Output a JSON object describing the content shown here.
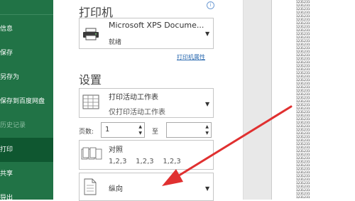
{
  "sidebar": {
    "items": [
      {
        "label": "信息",
        "state": "normal"
      },
      {
        "label": "保存",
        "state": "normal"
      },
      {
        "label": "另存为",
        "state": "normal"
      },
      {
        "label": "保存到百度网盘",
        "state": "normal"
      },
      {
        "label": "历史记录",
        "state": "disabled"
      },
      {
        "label": "打印",
        "state": "active"
      },
      {
        "label": "共享",
        "state": "normal"
      },
      {
        "label": "导出",
        "state": "normal"
      }
    ]
  },
  "printer": {
    "section_title": "打印机",
    "name": "Microsoft XPS Docume...",
    "status": "就绪",
    "properties_link": "打印机属性",
    "icon": "printer-icon",
    "info_icon": "info-icon"
  },
  "settings": {
    "section_title": "设置",
    "scope": {
      "title": "打印活动工作表",
      "subtitle": "仅打印活动工作表",
      "icon": "worksheet-grid-icon"
    },
    "pages": {
      "label": "页数:",
      "from": "1",
      "to_label": "至",
      "to": ""
    },
    "collate": {
      "title": "对照",
      "subtitle": "1,2,3    1,2,3    1,2,3",
      "icon": "collate-icon"
    },
    "orientation": {
      "title": "纵向",
      "icon": "portrait-page-icon"
    }
  },
  "preview": {
    "cells": [
      "1231231",
      "1231231",
      "1231231",
      "1231231",
      "1231231",
      "1231231",
      "1231231",
      "1231231",
      "1231231",
      "1231231",
      "1231231",
      "1231231",
      "1231231",
      "1231231",
      "1231231",
      "1231231",
      "1231231",
      "1231231",
      "1231231",
      "1231231",
      "1231231",
      "1231231",
      "1231231",
      "1231231",
      "1231231",
      "1231231",
      "1231231",
      "1231231",
      "1231231",
      "1231231",
      "1231231",
      "1231231",
      "1231231",
      "1231231",
      "1231231",
      "1231231",
      "1231231",
      "1231231",
      "1231231",
      "1231231",
      "1231231",
      "1231231",
      "1231231",
      "1231231",
      "1231231",
      "1231231",
      "1231231",
      "1231231",
      "1231231",
      "1231231",
      "1231231",
      "1231231",
      "1231231",
      "1231231",
      "1231231",
      "1231231"
    ]
  },
  "colors": {
    "sidebar_bg": "#217346",
    "sidebar_active": "#0f5730",
    "link": "#2b6ab0",
    "annotation_arrow": "#e03030"
  }
}
